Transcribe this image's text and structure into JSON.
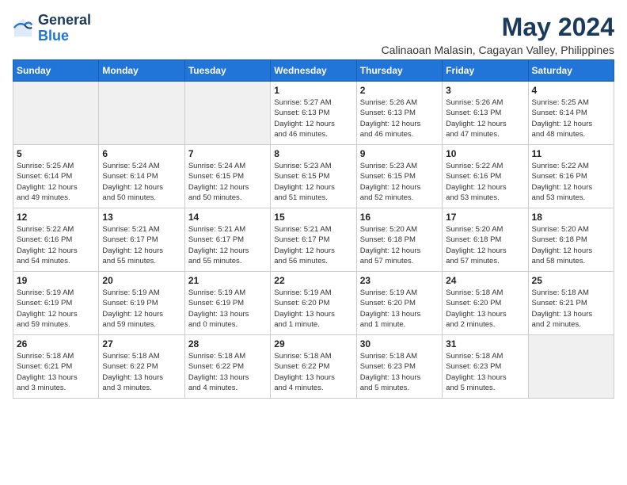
{
  "logo": {
    "line1": "General",
    "line2": "Blue"
  },
  "title": "May 2024",
  "location": "Calinaoan Malasin, Cagayan Valley, Philippines",
  "weekdays": [
    "Sunday",
    "Monday",
    "Tuesday",
    "Wednesday",
    "Thursday",
    "Friday",
    "Saturday"
  ],
  "weeks": [
    [
      {
        "day": "",
        "info": ""
      },
      {
        "day": "",
        "info": ""
      },
      {
        "day": "",
        "info": ""
      },
      {
        "day": "1",
        "info": "Sunrise: 5:27 AM\nSunset: 6:13 PM\nDaylight: 12 hours\nand 46 minutes."
      },
      {
        "day": "2",
        "info": "Sunrise: 5:26 AM\nSunset: 6:13 PM\nDaylight: 12 hours\nand 46 minutes."
      },
      {
        "day": "3",
        "info": "Sunrise: 5:26 AM\nSunset: 6:13 PM\nDaylight: 12 hours\nand 47 minutes."
      },
      {
        "day": "4",
        "info": "Sunrise: 5:25 AM\nSunset: 6:14 PM\nDaylight: 12 hours\nand 48 minutes."
      }
    ],
    [
      {
        "day": "5",
        "info": "Sunrise: 5:25 AM\nSunset: 6:14 PM\nDaylight: 12 hours\nand 49 minutes."
      },
      {
        "day": "6",
        "info": "Sunrise: 5:24 AM\nSunset: 6:14 PM\nDaylight: 12 hours\nand 50 minutes."
      },
      {
        "day": "7",
        "info": "Sunrise: 5:24 AM\nSunset: 6:15 PM\nDaylight: 12 hours\nand 50 minutes."
      },
      {
        "day": "8",
        "info": "Sunrise: 5:23 AM\nSunset: 6:15 PM\nDaylight: 12 hours\nand 51 minutes."
      },
      {
        "day": "9",
        "info": "Sunrise: 5:23 AM\nSunset: 6:15 PM\nDaylight: 12 hours\nand 52 minutes."
      },
      {
        "day": "10",
        "info": "Sunrise: 5:22 AM\nSunset: 6:16 PM\nDaylight: 12 hours\nand 53 minutes."
      },
      {
        "day": "11",
        "info": "Sunrise: 5:22 AM\nSunset: 6:16 PM\nDaylight: 12 hours\nand 53 minutes."
      }
    ],
    [
      {
        "day": "12",
        "info": "Sunrise: 5:22 AM\nSunset: 6:16 PM\nDaylight: 12 hours\nand 54 minutes."
      },
      {
        "day": "13",
        "info": "Sunrise: 5:21 AM\nSunset: 6:17 PM\nDaylight: 12 hours\nand 55 minutes."
      },
      {
        "day": "14",
        "info": "Sunrise: 5:21 AM\nSunset: 6:17 PM\nDaylight: 12 hours\nand 55 minutes."
      },
      {
        "day": "15",
        "info": "Sunrise: 5:21 AM\nSunset: 6:17 PM\nDaylight: 12 hours\nand 56 minutes."
      },
      {
        "day": "16",
        "info": "Sunrise: 5:20 AM\nSunset: 6:18 PM\nDaylight: 12 hours\nand 57 minutes."
      },
      {
        "day": "17",
        "info": "Sunrise: 5:20 AM\nSunset: 6:18 PM\nDaylight: 12 hours\nand 57 minutes."
      },
      {
        "day": "18",
        "info": "Sunrise: 5:20 AM\nSunset: 6:18 PM\nDaylight: 12 hours\nand 58 minutes."
      }
    ],
    [
      {
        "day": "19",
        "info": "Sunrise: 5:19 AM\nSunset: 6:19 PM\nDaylight: 12 hours\nand 59 minutes."
      },
      {
        "day": "20",
        "info": "Sunrise: 5:19 AM\nSunset: 6:19 PM\nDaylight: 12 hours\nand 59 minutes."
      },
      {
        "day": "21",
        "info": "Sunrise: 5:19 AM\nSunset: 6:19 PM\nDaylight: 13 hours\nand 0 minutes."
      },
      {
        "day": "22",
        "info": "Sunrise: 5:19 AM\nSunset: 6:20 PM\nDaylight: 13 hours\nand 1 minute."
      },
      {
        "day": "23",
        "info": "Sunrise: 5:19 AM\nSunset: 6:20 PM\nDaylight: 13 hours\nand 1 minute."
      },
      {
        "day": "24",
        "info": "Sunrise: 5:18 AM\nSunset: 6:20 PM\nDaylight: 13 hours\nand 2 minutes."
      },
      {
        "day": "25",
        "info": "Sunrise: 5:18 AM\nSunset: 6:21 PM\nDaylight: 13 hours\nand 2 minutes."
      }
    ],
    [
      {
        "day": "26",
        "info": "Sunrise: 5:18 AM\nSunset: 6:21 PM\nDaylight: 13 hours\nand 3 minutes."
      },
      {
        "day": "27",
        "info": "Sunrise: 5:18 AM\nSunset: 6:22 PM\nDaylight: 13 hours\nand 3 minutes."
      },
      {
        "day": "28",
        "info": "Sunrise: 5:18 AM\nSunset: 6:22 PM\nDaylight: 13 hours\nand 4 minutes."
      },
      {
        "day": "29",
        "info": "Sunrise: 5:18 AM\nSunset: 6:22 PM\nDaylight: 13 hours\nand 4 minutes."
      },
      {
        "day": "30",
        "info": "Sunrise: 5:18 AM\nSunset: 6:23 PM\nDaylight: 13 hours\nand 5 minutes."
      },
      {
        "day": "31",
        "info": "Sunrise: 5:18 AM\nSunset: 6:23 PM\nDaylight: 13 hours\nand 5 minutes."
      },
      {
        "day": "",
        "info": ""
      }
    ]
  ]
}
